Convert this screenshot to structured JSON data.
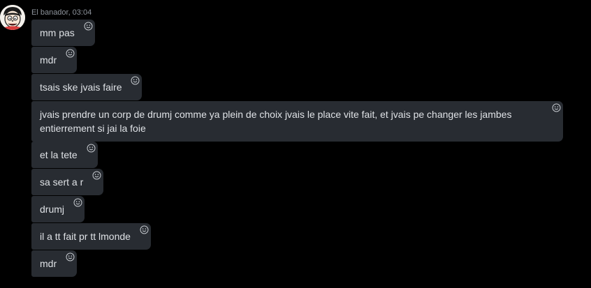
{
  "message_group": {
    "author": "El banador",
    "time": "03:04",
    "separator": ",",
    "reaction_icon": "smiley-add-reaction-icon",
    "colors": {
      "background": "#000000",
      "bubble": "#282c32",
      "text": "#dfe2e6",
      "meta": "#8e949c"
    },
    "messages": [
      {
        "text": "mm pas"
      },
      {
        "text": "mdr"
      },
      {
        "text": "tsais ske jvais faire"
      },
      {
        "text": "jvais prendre un corp de drumj comme ya plein de choix jvais le place vite fait, et jvais pe changer les jambes entierrement si jai la foie"
      },
      {
        "text": "et la tete"
      },
      {
        "text": "sa sert a r"
      },
      {
        "text": "drumj"
      },
      {
        "text": "il a tt fait pr tt lmonde"
      },
      {
        "text": "mdr"
      }
    ]
  }
}
